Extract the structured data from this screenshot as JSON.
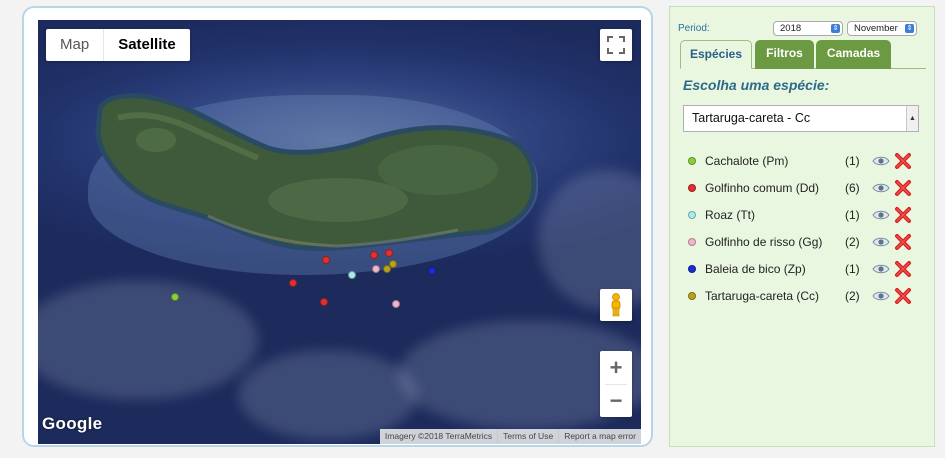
{
  "map": {
    "type_control": {
      "map_label": "Map",
      "satellite_label": "Satellite"
    },
    "logo": "Google",
    "attribution": [
      "Imagery ©2018 TerraMetrics",
      "Terms of Use",
      "Report a map error"
    ],
    "zoom_in": "+",
    "zoom_out": "−",
    "icons": {
      "fullscreen": "fullscreen-icon",
      "pegman": "pegman-icon"
    }
  },
  "panel": {
    "period_label": "Period:",
    "year": "2018",
    "month": "November",
    "tabs": [
      {
        "label": "Espécies",
        "active": true
      },
      {
        "label": "Filtros",
        "active": false
      },
      {
        "label": "Camadas",
        "active": false
      }
    ],
    "choose_heading": "Escolha uma espécie:",
    "selected_species": "Tartaruga-careta - Cc",
    "species": [
      {
        "name": "Cachalote (Pm)",
        "count": "(1)",
        "color": "#8bd03a"
      },
      {
        "name": "Golfinho comum (Dd)",
        "count": "(6)",
        "color": "#e03030"
      },
      {
        "name": "Roaz (Tt)",
        "count": "(1)",
        "color": "#a8ecec"
      },
      {
        "name": "Golfinho de risso (Gg)",
        "count": "(2)",
        "color": "#f2b6cc"
      },
      {
        "name": "Baleia de bico (Zp)",
        "count": "(1)",
        "color": "#1a2ed6"
      },
      {
        "name": "Tartaruga-careta (Cc)",
        "count": "(2)",
        "color": "#b8a21e"
      }
    ],
    "row_icons": {
      "visibility": "eye-icon",
      "remove": "red-x-icon"
    }
  }
}
